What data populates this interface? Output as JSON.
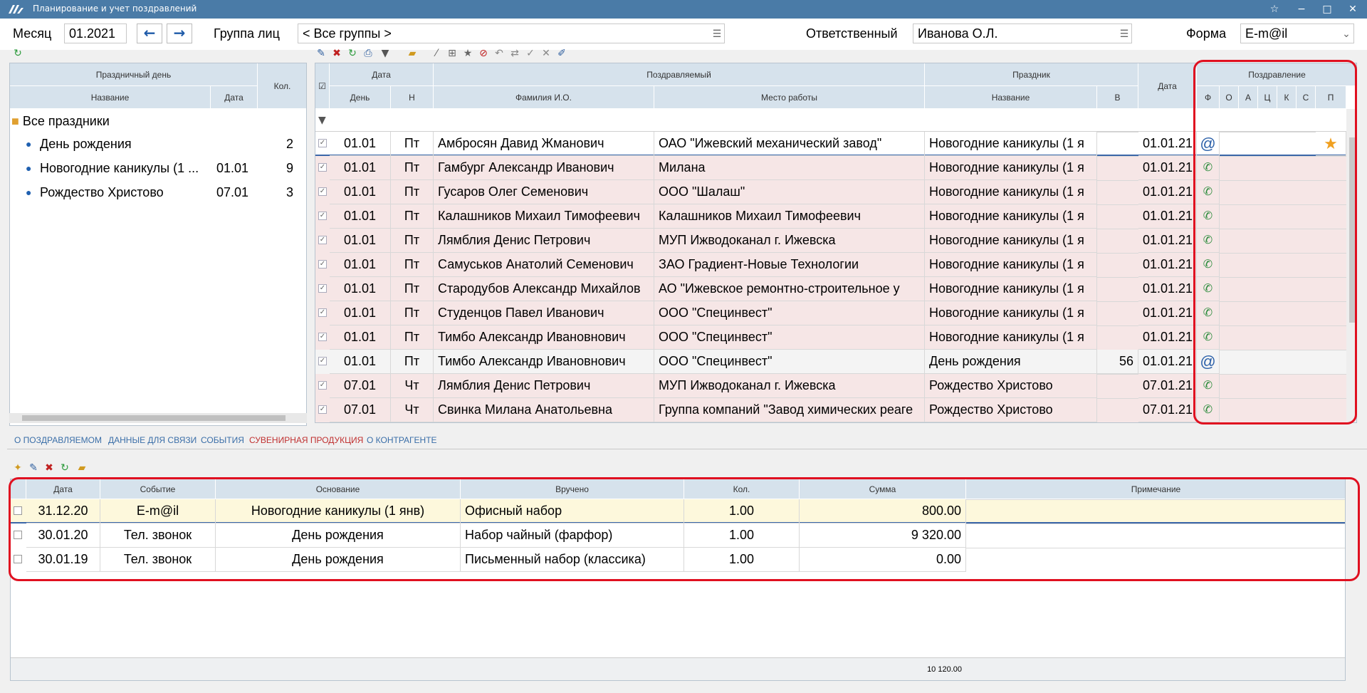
{
  "window": {
    "title": "Планирование и учет поздравлений",
    "btn_star": "☆",
    "btn_min": "−",
    "btn_max": "□",
    "btn_close": "✕"
  },
  "header": {
    "month_label": "Месяц",
    "month_value": "01.2021",
    "group_label": "Группа лиц",
    "group_value": "< Все группы >",
    "resp_label": "Ответственный",
    "resp_value": "Иванова О.Л.",
    "form_label": "Форма",
    "form_value": "E-m@il"
  },
  "holidays": {
    "header_top": "Праздничный день",
    "col_name": "Название",
    "col_date": "Дата",
    "col_count": "Кол.",
    "root": "Все праздники",
    "items": [
      {
        "name": "День рождения",
        "date": "",
        "count": "2"
      },
      {
        "name": "Новогодние каникулы (1 ...",
        "date": "01.01",
        "count": "9"
      },
      {
        "name": "Рождество Христово",
        "date": "07.01",
        "count": "3"
      }
    ]
  },
  "main": {
    "grp_date": "Дата",
    "grp_person": "Поздравляемый",
    "grp_holiday": "Праздник",
    "grp_congrats": "Поздравление",
    "col_day": "День",
    "col_n": "Н",
    "col_fio": "Фамилия И.О.",
    "col_work": "Место работы",
    "col_hname": "Название",
    "col_v": "В",
    "col_hdate": "Дата",
    "col_f": "Ф",
    "col_o": "О",
    "col_a": "А",
    "col_c": "Ц",
    "col_k": "К",
    "col_s": "С",
    "col_p": "П",
    "rows": [
      {
        "day": "01.01",
        "n": "Пт",
        "fio": "Амбросян Давид Жманович",
        "work": "ОАО \"Ижевский механический завод\"",
        "hname": "Новогодние каникулы (1 я",
        "v": "",
        "hdate": "01.01.21",
        "f": "@",
        "o": "☐",
        "a": "☐",
        "c": "☐",
        "k": "☐",
        "s": "☑",
        "p": "★"
      },
      {
        "day": "01.01",
        "n": "Пт",
        "fio": "Гамбург Александр Иванович",
        "work": "Милана",
        "hname": "Новогодние каникулы (1 я",
        "v": "",
        "hdate": "01.01.21",
        "f": "📞",
        "o": "",
        "a": "",
        "c": "",
        "k": "",
        "s": "",
        "p": ""
      },
      {
        "day": "01.01",
        "n": "Пт",
        "fio": "Гусаров Олег Семенович",
        "work": "ООО \"Шалаш\"",
        "hname": "Новогодние каникулы (1 я",
        "v": "",
        "hdate": "01.01.21",
        "f": "📞",
        "o": "",
        "a": "",
        "c": "",
        "k": "",
        "s": "",
        "p": ""
      },
      {
        "day": "01.01",
        "n": "Пт",
        "fio": "Калашников Михаил Тимофеевич",
        "work": "Калашников Михаил Тимофеевич",
        "hname": "Новогодние каникулы (1 я",
        "v": "",
        "hdate": "01.01.21",
        "f": "📞",
        "o": "",
        "a": "",
        "c": "✓",
        "k": "✓",
        "s": "✓",
        "p": ""
      },
      {
        "day": "01.01",
        "n": "Пт",
        "fio": "Лямблия Денис Петрович",
        "work": "МУП Ижводоканал г. Ижевска",
        "hname": "Новогодние каникулы (1 я",
        "v": "",
        "hdate": "01.01.21",
        "f": "📞",
        "o": "✓",
        "a": "",
        "c": "",
        "k": "✓",
        "s": "",
        "p": ""
      },
      {
        "day": "01.01",
        "n": "Пт",
        "fio": "Самуськов Анатолий Семенович",
        "work": "ЗАО Градиент-Новые Технологии",
        "hname": "Новогодние каникулы (1 я",
        "v": "",
        "hdate": "01.01.21",
        "f": "📞",
        "o": "",
        "a": "",
        "c": "",
        "k": "",
        "s": "",
        "p": ""
      },
      {
        "day": "01.01",
        "n": "Пт",
        "fio": "Стародубов Александр Михайлов",
        "work": "АО \"Ижевское ремонтно-строительное у",
        "hname": "Новогодние каникулы (1 я",
        "v": "",
        "hdate": "01.01.21",
        "f": "📞",
        "o": "✓",
        "a": "",
        "c": "",
        "k": "✓",
        "s": "",
        "p": ""
      },
      {
        "day": "01.01",
        "n": "Пт",
        "fio": "Студенцов Павел Иванович",
        "work": "ООО \"Специнвест\"",
        "hname": "Новогодние каникулы (1 я",
        "v": "",
        "hdate": "01.01.21",
        "f": "📞",
        "o": "✓",
        "a": "",
        "c": "",
        "k": "✓",
        "s": "",
        "p": ""
      },
      {
        "day": "01.01",
        "n": "Пт",
        "fio": "Тимбо Александр Ивановнович",
        "work": "ООО \"Специнвест\"",
        "hname": "Новогодние каникулы (1 я",
        "v": "",
        "hdate": "01.01.21",
        "f": "📞",
        "o": "",
        "a": "",
        "c": "",
        "k": "",
        "s": "",
        "p": ""
      },
      {
        "day": "01.01",
        "n": "Пт",
        "fio": "Тимбо Александр Ивановнович",
        "work": "ООО \"Специнвест\"",
        "hname": "День рождения",
        "v": "56",
        "hdate": "01.01.21",
        "f": "@",
        "o": "",
        "a": "",
        "c": "✓",
        "k": "",
        "s": "✓",
        "p": ""
      },
      {
        "day": "07.01",
        "n": "Чт",
        "fio": "Лямблия Денис Петрович",
        "work": "МУП Ижводоканал г. Ижевска",
        "hname": "Рождество Христово",
        "v": "",
        "hdate": "07.01.21",
        "f": "📞",
        "o": "✓",
        "a": "",
        "c": "",
        "k": "✓",
        "s": "",
        "p": ""
      },
      {
        "day": "07.01",
        "n": "Чт",
        "fio": "Свинка Милана Анатольевна",
        "work": "Группа компаний \"Завод химических реаге",
        "hname": "Рождество Христово",
        "v": "",
        "hdate": "07.01.21",
        "f": "📞",
        "o": "✓",
        "a": "",
        "c": "",
        "k": "✓",
        "s": "",
        "p": ""
      }
    ]
  },
  "tabs": [
    "О ПОЗДРАВЛЯЕМОМ",
    "ДАННЫЕ ДЛЯ СВЯЗИ",
    "СОБЫТИЯ",
    "СУВЕНИРНАЯ ПРОДУКЦИЯ",
    "О КОНТРАГЕНТЕ"
  ],
  "souvenir": {
    "col_date": "Дата",
    "col_event": "Событие",
    "col_basis": "Основание",
    "col_given": "Вручено",
    "col_qty": "Кол.",
    "col_sum": "Сумма",
    "col_note": "Примечание",
    "rows": [
      {
        "date": "31.12.20",
        "event": "E-m@il",
        "basis": "Новогодние каникулы (1 янв)",
        "given": "Офисный набор",
        "qty": "1.00",
        "sum": "800.00",
        "note": ""
      },
      {
        "date": "30.01.20",
        "event": "Тел. звонок",
        "basis": "День рождения",
        "given": "Набор чайный (фарфор)",
        "qty": "1.00",
        "sum": "9 320.00",
        "note": ""
      },
      {
        "date": "30.01.19",
        "event": "Тел. звонок",
        "basis": "День рождения",
        "given": "Письменный набор (классика)",
        "qty": "1.00",
        "sum": "0.00",
        "note": ""
      }
    ],
    "total": "10 120.00"
  }
}
